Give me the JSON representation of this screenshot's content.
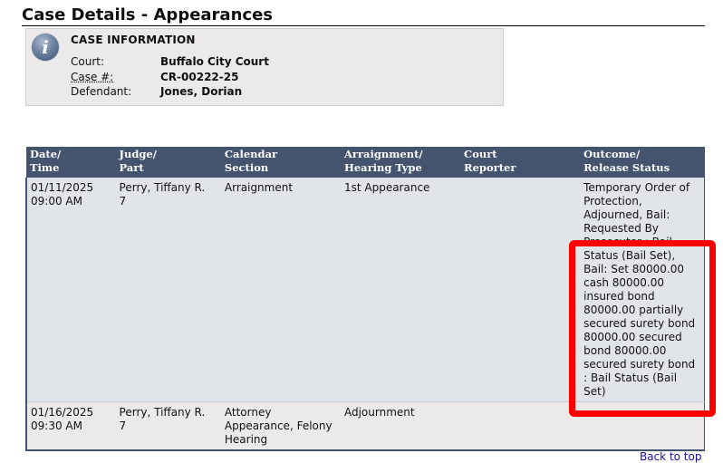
{
  "page": {
    "title": "Case Details - Appearances"
  },
  "case_information": {
    "icon": "info-icon",
    "icon_glyph": "i",
    "heading": "CASE INFORMATION",
    "fields": [
      {
        "label": "Court:",
        "value": "Buffalo City Court"
      },
      {
        "label": "Case #:",
        "value": "CR-00222-25"
      },
      {
        "label": "Defendant:",
        "value": "Jones, Dorian"
      }
    ]
  },
  "appearances_table": {
    "columns": [
      {
        "line1": "Date/",
        "line2": "Time"
      },
      {
        "line1": "Judge/",
        "line2": "Part"
      },
      {
        "line1": "Calendar",
        "line2": "Section"
      },
      {
        "line1": "Arraignment/",
        "line2": "Hearing Type"
      },
      {
        "line1": "Court",
        "line2": "Reporter"
      },
      {
        "line1": "Outcome/",
        "line2": "Release Status"
      }
    ],
    "rows": [
      {
        "date": "01/11/2025",
        "time": "09:00 AM",
        "judge": "Perry, Tiffany R.",
        "part": "7",
        "calendar_section": "Arraignment",
        "hearing_type": "1st Appearance",
        "court_reporter": "",
        "outcome": "Temporary Order of Protection, Adjourned, Bail: Requested By Prosecutor : Bail Status (Bail Set), Bail: Set 80000.00 cash 80000.00 insured bond 80000.00 partially secured surety bond 80000.00 secured bond 80000.00 secured surety bond : Bail Status (Bail Set)"
      },
      {
        "date": "01/16/2025",
        "time": "09:30 AM",
        "judge": "Perry, Tiffany R.",
        "part": "7",
        "calendar_section": "Attorney Appearance, Felony Hearing",
        "hearing_type": "Adjournment",
        "court_reporter": "",
        "outcome": ""
      }
    ]
  },
  "annotation": {
    "highlight_color": "#ff0000",
    "highlighted": "appearances_table.rows.0.outcome"
  },
  "footer": {
    "back_to_top": "Back to top"
  },
  "colors": {
    "header_bg": "#44546e",
    "row_alt_bg": "#e1e5ea",
    "info_box_bg": "#ebe9ea"
  }
}
